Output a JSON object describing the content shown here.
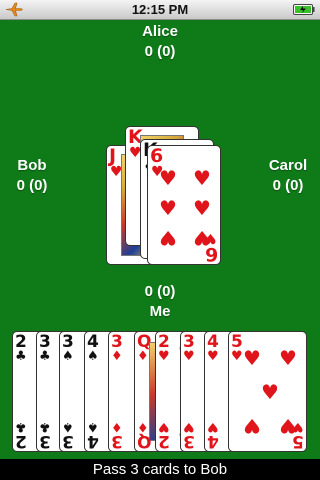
{
  "status": {
    "time": "12:15 PM",
    "airplane_icon": "airplane-icon",
    "battery_icon": "battery-charging-icon"
  },
  "players": {
    "top": {
      "name": "Alice",
      "score": "0 (0)"
    },
    "left": {
      "name": "Bob",
      "score": "0 (0)"
    },
    "right": {
      "name": "Carol",
      "score": "0 (0)"
    },
    "me": {
      "name": "Me",
      "score": "0 (0)"
    }
  },
  "center_cards": [
    {
      "rank": "J",
      "suit": "♥",
      "color": "red"
    },
    {
      "rank": "K",
      "suit": "♥",
      "color": "red"
    },
    {
      "rank": "K",
      "suit": "♣",
      "color": "black"
    },
    {
      "rank": "6",
      "suit": "♥",
      "color": "red"
    }
  ],
  "hand": [
    {
      "rank": "2",
      "suit": "♣",
      "color": "black"
    },
    {
      "rank": "3",
      "suit": "♣",
      "color": "black"
    },
    {
      "rank": "3",
      "suit": "♠",
      "color": "black"
    },
    {
      "rank": "4",
      "suit": "♠",
      "color": "black"
    },
    {
      "rank": "3",
      "suit": "♦",
      "color": "red"
    },
    {
      "rank": "Q",
      "suit": "♦",
      "color": "red"
    },
    {
      "rank": "2",
      "suit": "♥",
      "color": "red"
    },
    {
      "rank": "3",
      "suit": "♥",
      "color": "red"
    },
    {
      "rank": "4",
      "suit": "♥",
      "color": "red"
    },
    {
      "rank": "5",
      "suit": "♥",
      "color": "red"
    }
  ],
  "message": "Pass 3 cards to Bob",
  "colors": {
    "felt": "#0f7a18",
    "red_suit": "#e0151b",
    "black_suit": "#111111"
  }
}
